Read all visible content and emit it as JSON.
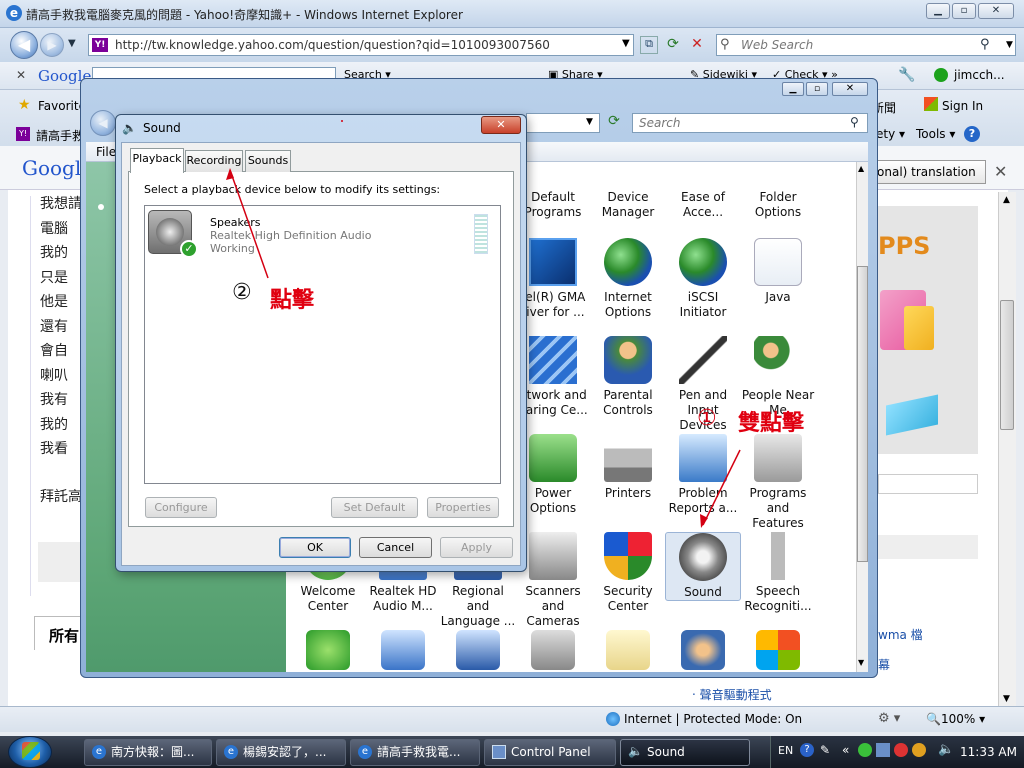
{
  "ie": {
    "title": "請高手救我電腦麥克風的問題 - Yahoo!奇摩知識+ - Windows Internet Explorer",
    "address": "http://tw.knowledge.yahoo.com/question/question?qid=1010093007560",
    "search_placeholder": "Web Search",
    "google_search": "Search",
    "share": "Share",
    "sidewiki": "Sidewiki",
    "check": "Check",
    "user": "jimcch...",
    "favorites": "Favorite",
    "tab_title": "請高手救",
    "news": "新聞",
    "sign_in": "Sign In",
    "safety": "ety",
    "tools": "Tools",
    "translate": "tional) translation",
    "status": "Internet | Protected Mode: On",
    "zoom": "100%"
  },
  "page": {
    "lines": [
      "我想請",
      "電腦",
      "我的",
      "只是",
      "他是",
      "還有",
      "會自",
      "喇叭",
      "我有",
      "我的",
      "我看"
    ],
    "closing": "拜託高",
    "tab_all": "所有",
    "right_links": [
      "wma 檔",
      "幕",
      "‧ 聲音驅動程式"
    ],
    "apps": "PPS"
  },
  "cp": {
    "search_placeholder": "Search",
    "file_menu": "File",
    "items": [
      {
        "label": "Default Programs",
        "icon": "default-programs-icon"
      },
      {
        "label": "Device Manager",
        "icon": "device-manager-icon"
      },
      {
        "label": "Ease of Acce...",
        "icon": "ease-of-access-icon"
      },
      {
        "label": "Folder Options",
        "icon": "folder-options-icon"
      },
      {
        "label": "tel(R) GMA river for ...",
        "icon": "intel-gma-icon"
      },
      {
        "label": "Internet Options",
        "icon": "internet-options-icon"
      },
      {
        "label": "iSCSI Initiator",
        "icon": "iscsi-icon"
      },
      {
        "label": "Java",
        "icon": "java-icon"
      },
      {
        "label": "etwork and haring Ce...",
        "icon": "network-icon"
      },
      {
        "label": "Parental Controls",
        "icon": "parental-controls-icon"
      },
      {
        "label": "Pen and Input Devices",
        "icon": "pen-icon"
      },
      {
        "label": "People Near Me",
        "icon": "people-near-me-icon"
      },
      {
        "label": "Power Options",
        "icon": "power-options-icon"
      },
      {
        "label": "Printers",
        "icon": "printers-icon"
      },
      {
        "label": "Problem Reports a...",
        "icon": "problem-reports-icon"
      },
      {
        "label": "Programs and Features",
        "icon": "programs-icon"
      },
      {
        "label": "Welcome Center",
        "icon": "welcome-center-icon"
      },
      {
        "label": "Realtek HD Audio M...",
        "icon": "realtek-icon"
      },
      {
        "label": "Regional and Language ...",
        "icon": "regional-icon"
      },
      {
        "label": "Scanners and Cameras",
        "icon": "scanners-icon"
      },
      {
        "label": "Security Center",
        "icon": "security-center-icon"
      },
      {
        "label": "Sound",
        "icon": "sound-icon"
      },
      {
        "label": "Speech Recogniti...",
        "icon": "speech-icon"
      }
    ]
  },
  "sound": {
    "title": "Sound",
    "tabs": [
      "Playback",
      "Recording",
      "Sounds"
    ],
    "instruction": "Select a playback device below to modify its settings:",
    "device": {
      "name": "Speakers",
      "driver": "Realtek High Definition Audio",
      "status": "Working"
    },
    "buttons": {
      "configure": "Configure",
      "set_default": "Set Default",
      "properties": "Properties",
      "ok": "OK",
      "cancel": "Cancel",
      "apply": "Apply"
    }
  },
  "annotations": {
    "step1": "①",
    "step1_text": "雙點擊",
    "step2": "②",
    "step2_text": "點擊"
  },
  "taskbar": {
    "items": [
      "南方快報：圖...",
      "楊錫安認了，...",
      "請高手救我電...",
      "Control Panel",
      "Sound"
    ],
    "lang": "EN",
    "clock": "11:33 AM"
  }
}
